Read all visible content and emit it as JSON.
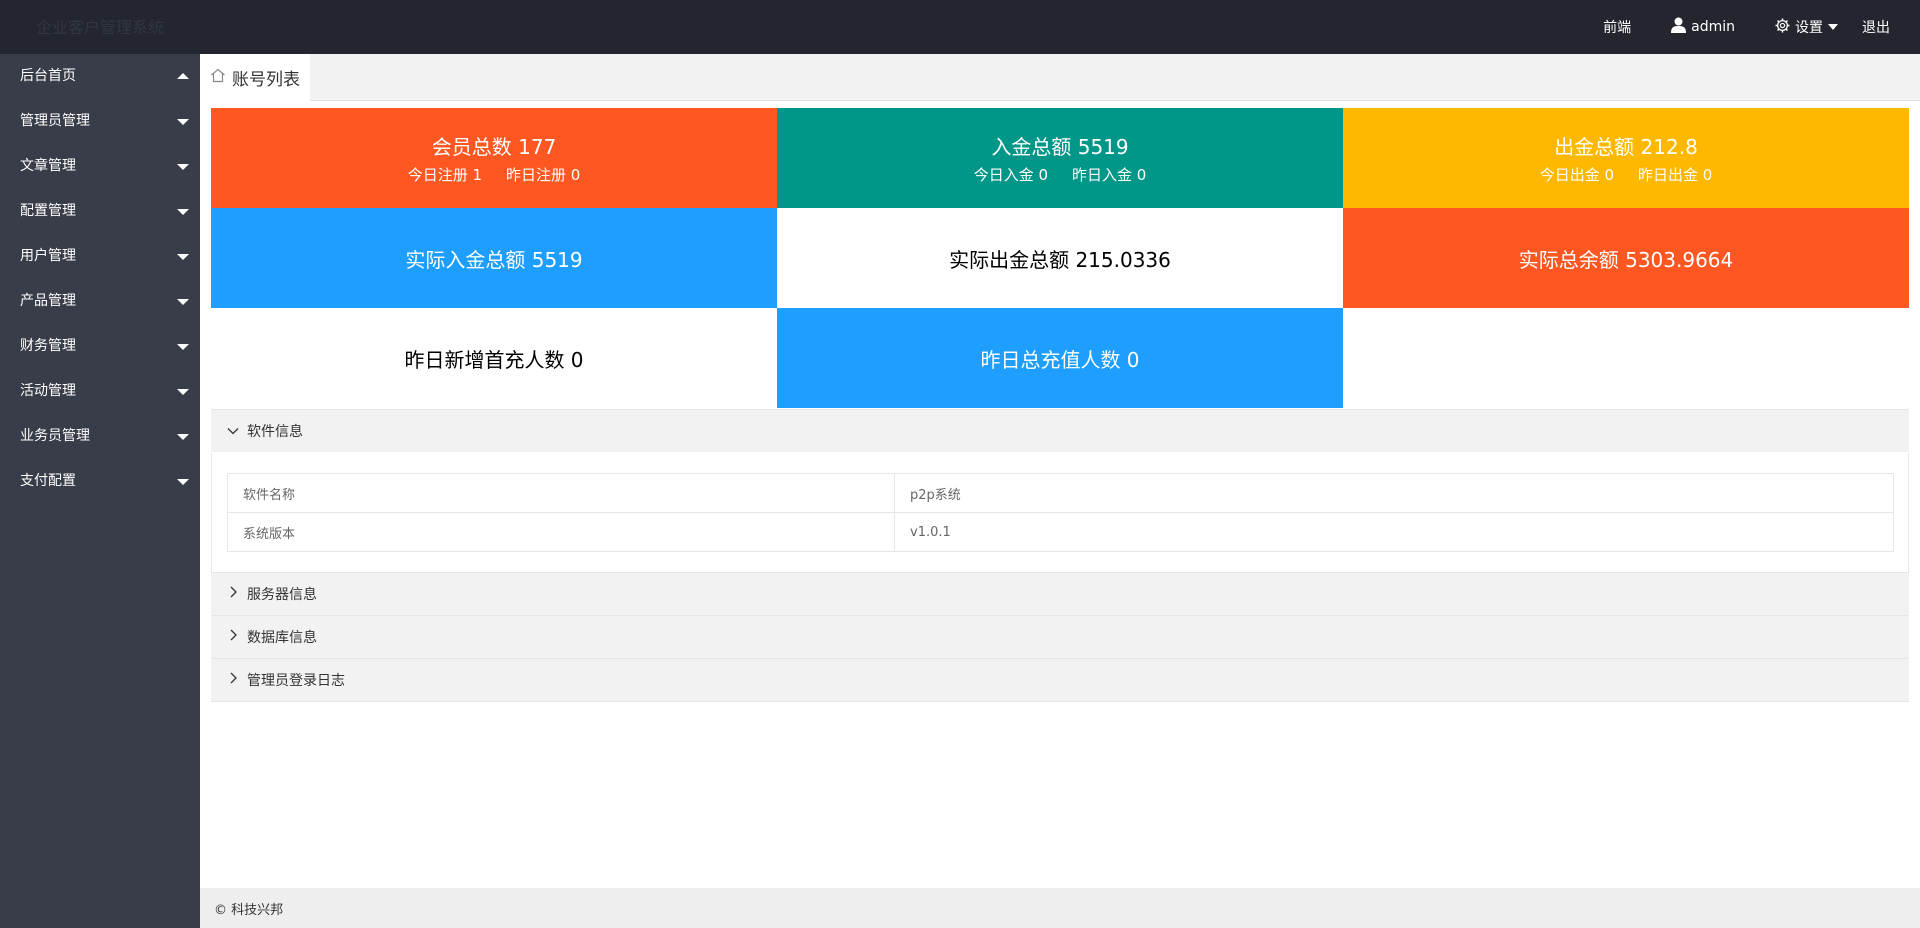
{
  "header": {
    "brand": "企业客户管理系统",
    "nav": {
      "frontend": "前端",
      "user": "admin",
      "settings": "设置",
      "logout": "退出"
    }
  },
  "sidebar": {
    "items": [
      {
        "label": "后台首页"
      },
      {
        "label": "管理员管理"
      },
      {
        "label": "文章管理"
      },
      {
        "label": "配置管理"
      },
      {
        "label": "用户管理"
      },
      {
        "label": "产品管理"
      },
      {
        "label": "财务管理"
      },
      {
        "label": "活动管理"
      },
      {
        "label": "业务员管理"
      },
      {
        "label": "支付配置"
      }
    ]
  },
  "tab": {
    "label": "账号列表"
  },
  "stats": {
    "members": {
      "main": "会员总数 177",
      "sub1": "今日注册 1",
      "sub2": "昨日注册 0"
    },
    "deposit": {
      "main": "入金总额 5519",
      "sub1": "今日入金 0",
      "sub2": "昨日入金 0"
    },
    "withdraw": {
      "main": "出金总额 212.8",
      "sub1": "今日出金 0",
      "sub2": "昨日出金 0"
    },
    "actual_deposit": {
      "main": "实际入金总额 5519"
    },
    "actual_withdraw": {
      "main": "实际出金总额 215.0336"
    },
    "actual_balance": {
      "main": "实际总余额 5303.9664"
    },
    "first_recharge": {
      "main": "昨日新增首充人数 0"
    },
    "recharge_users": {
      "main": "昨日总充值人数 0"
    }
  },
  "panels": {
    "software": {
      "title": "软件信息",
      "rows": [
        {
          "key": "软件名称",
          "value": "p2p系统"
        },
        {
          "key": "系统版本",
          "value": "v1.0.1"
        }
      ]
    },
    "server": {
      "title": "服务器信息"
    },
    "database": {
      "title": "数据库信息"
    },
    "login_log": {
      "title": "管理员登录日志"
    }
  },
  "footer": {
    "text": "© 科技兴邦"
  },
  "colors": {
    "orange": "#ff5722",
    "green": "#009688",
    "yellow": "#ffb800",
    "blue": "#1e9fff",
    "sidebar": "#393d49",
    "topbar": "#23262e"
  }
}
